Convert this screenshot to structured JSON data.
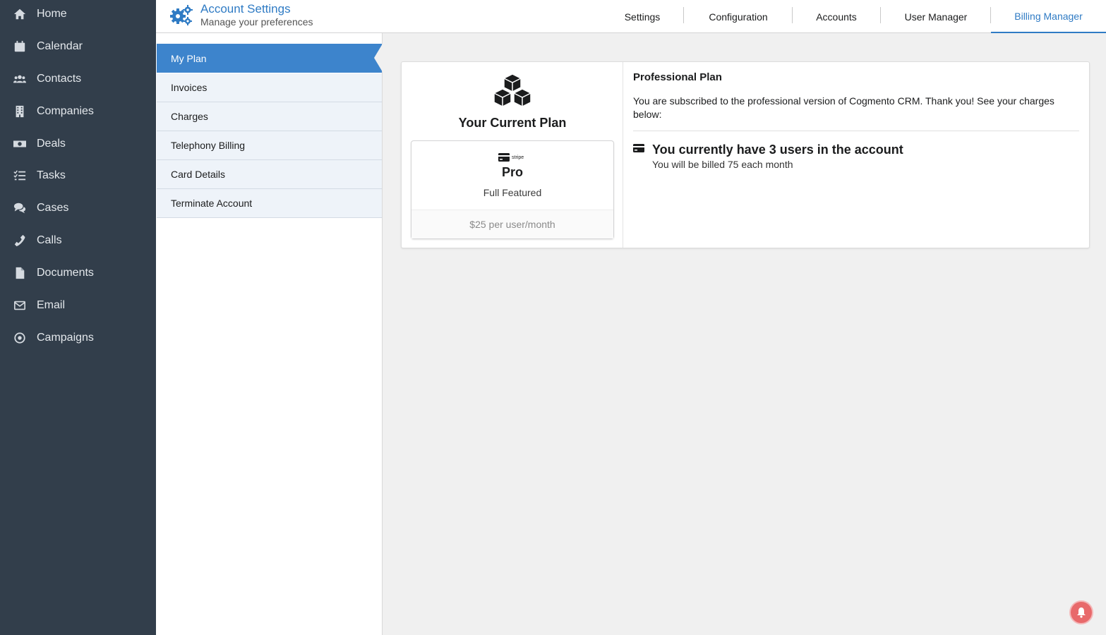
{
  "sidebar": {
    "items": [
      {
        "label": "Home",
        "icon": "home-icon"
      },
      {
        "label": "Calendar",
        "icon": "calendar-icon"
      },
      {
        "label": "Contacts",
        "icon": "users-icon"
      },
      {
        "label": "Companies",
        "icon": "building-icon"
      },
      {
        "label": "Deals",
        "icon": "money-icon"
      },
      {
        "label": "Tasks",
        "icon": "tasks-icon"
      },
      {
        "label": "Cases",
        "icon": "comments-icon"
      },
      {
        "label": "Calls",
        "icon": "phone-icon"
      },
      {
        "label": "Documents",
        "icon": "file-icon"
      },
      {
        "label": "Email",
        "icon": "envelope-icon"
      },
      {
        "label": "Campaigns",
        "icon": "target-icon"
      }
    ]
  },
  "header": {
    "title": "Account Settings",
    "subtitle": "Manage your preferences",
    "tabs": [
      {
        "label": "Settings"
      },
      {
        "label": "Configuration"
      },
      {
        "label": "Accounts"
      },
      {
        "label": "User Manager"
      },
      {
        "label": "Billing Manager",
        "active": true
      }
    ]
  },
  "submenu": {
    "items": [
      {
        "label": "My Plan",
        "active": true
      },
      {
        "label": "Invoices"
      },
      {
        "label": "Charges"
      },
      {
        "label": "Telephony Billing"
      },
      {
        "label": "Card Details"
      },
      {
        "label": "Terminate Account"
      }
    ]
  },
  "plan": {
    "current_label": "Your Current Plan",
    "brand": "stripe",
    "name": "Pro",
    "description": "Full Featured",
    "price": "$25 per user/month"
  },
  "details": {
    "title": "Professional Plan",
    "text": "You are subscribed to the professional version of Cogmento CRM. Thank you! See your charges below:",
    "users_title": "You currently have 3 users in the account",
    "users_sub": "You will be billed 75 each month"
  },
  "colors": {
    "sidebar_bg": "#323e4b",
    "accent": "#2f7bc4",
    "active_submenu": "#3d84cc",
    "notification": "#e8696b"
  }
}
